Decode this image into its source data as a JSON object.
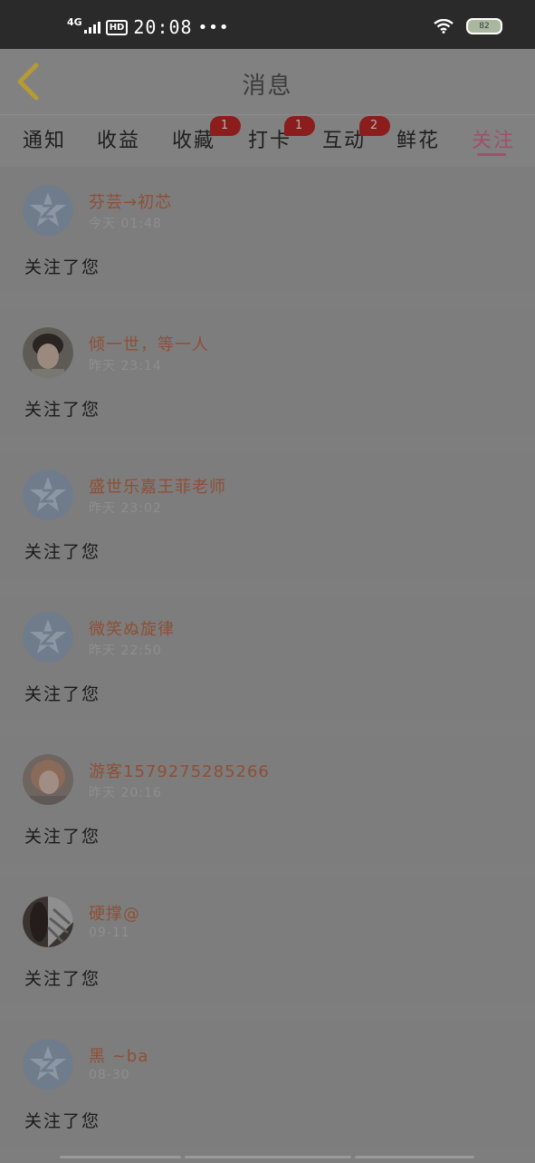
{
  "status_bar": {
    "network": "4G",
    "hd": "HD",
    "time": "20:08",
    "more": "•••",
    "battery": "82"
  },
  "header": {
    "title": "消息"
  },
  "tabs": [
    {
      "label": "通知",
      "badge": ""
    },
    {
      "label": "收益",
      "badge": ""
    },
    {
      "label": "收藏",
      "badge": "1"
    },
    {
      "label": "打卡",
      "badge": "1"
    },
    {
      "label": "互动",
      "badge": "2"
    },
    {
      "label": "鲜花",
      "badge": ""
    },
    {
      "label": "关注",
      "badge": "",
      "active": true
    }
  ],
  "messages": [
    {
      "name": "芬芸→初芯",
      "time": "今天 01:48",
      "text": "关注了您",
      "avatar": "default-star-icon"
    },
    {
      "name": "倾一世，等一人",
      "time": "昨天 23:14",
      "text": "关注了您",
      "avatar": "user-photo"
    },
    {
      "name": "盛世乐嘉王菲老师",
      "time": "昨天 23:02",
      "text": "关注了您",
      "avatar": "default-star-icon"
    },
    {
      "name": "微笑ぬ旋律",
      "time": "昨天 22:50",
      "text": "关注了您",
      "avatar": "default-star-icon"
    },
    {
      "name": "游客1579275285266",
      "time": "昨天 20:16",
      "text": "关注了您",
      "avatar": "user-photo"
    },
    {
      "name": "硬撑@",
      "time": "09-11",
      "text": "关注了您",
      "avatar": "user-photo"
    },
    {
      "name": "黑 ~ba",
      "time": "08-30",
      "text": "关注了您",
      "avatar": "default-star-icon"
    }
  ],
  "colors": {
    "accent": "#a1506a",
    "name": "#8e4f36",
    "badge": "#8b1d1d",
    "back_icon": "#b59a35"
  }
}
